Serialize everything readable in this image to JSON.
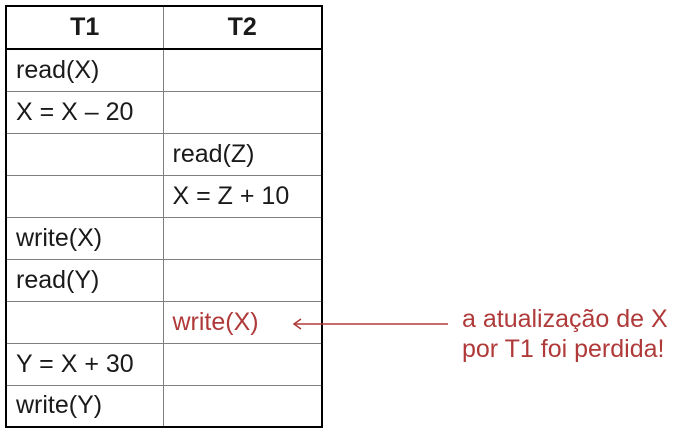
{
  "table": {
    "headers": [
      "T1",
      "T2"
    ],
    "rows": [
      [
        "read(X)",
        ""
      ],
      [
        "X = X – 20",
        ""
      ],
      [
        "",
        "read(Z)"
      ],
      [
        "",
        "X = Z + 10"
      ],
      [
        "write(X)",
        ""
      ],
      [
        "read(Y)",
        ""
      ],
      [
        "",
        "write(X)"
      ],
      [
        "Y = X + 30",
        ""
      ],
      [
        "write(Y)",
        ""
      ]
    ]
  },
  "annotation": {
    "line1": "a atualização de X",
    "line2": "por T1 foi perdida!"
  },
  "colors": {
    "highlight": "#b03a3a",
    "text": "#1a1a1a",
    "border": "#7f7f7f"
  }
}
